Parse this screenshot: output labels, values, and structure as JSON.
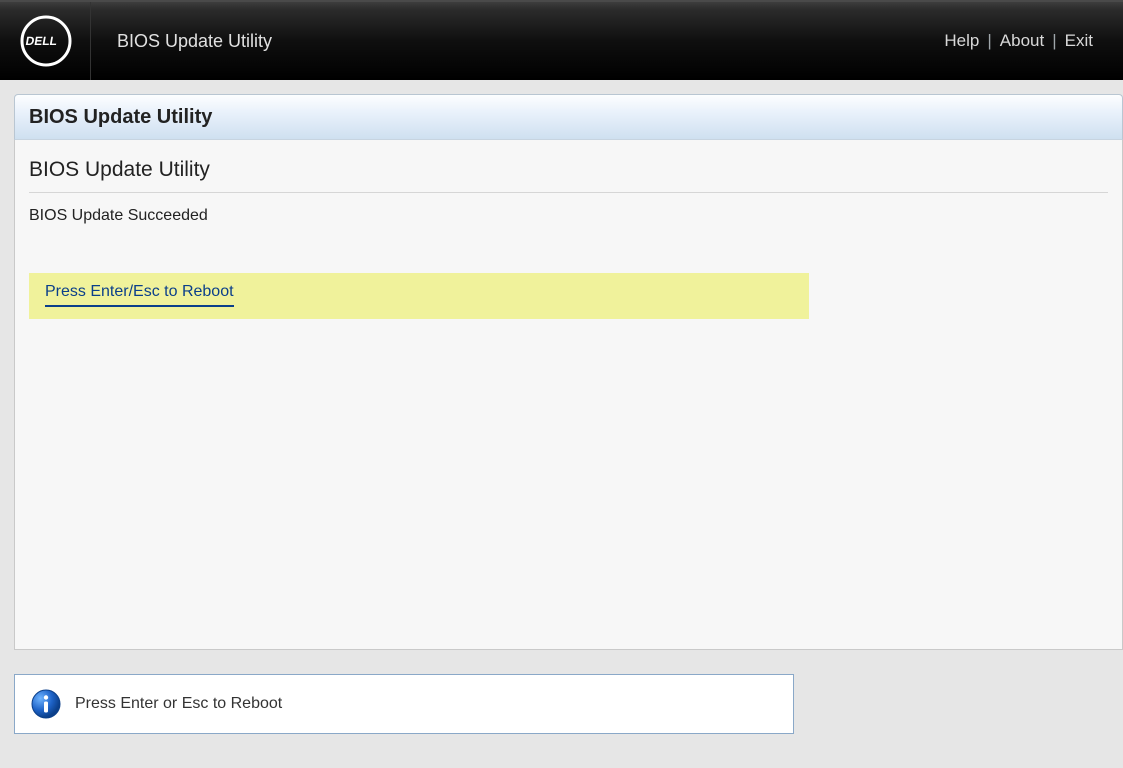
{
  "header": {
    "app_title": "BIOS Update Utility",
    "links": {
      "help": "Help",
      "about": "About",
      "exit": "Exit"
    }
  },
  "panel": {
    "title": "BIOS Update Utility",
    "section_title": "BIOS Update Utility",
    "status": "BIOS Update Succeeded",
    "action_text": "Press Enter/Esc to Reboot"
  },
  "footer": {
    "message": "Press Enter or Esc to Reboot"
  }
}
